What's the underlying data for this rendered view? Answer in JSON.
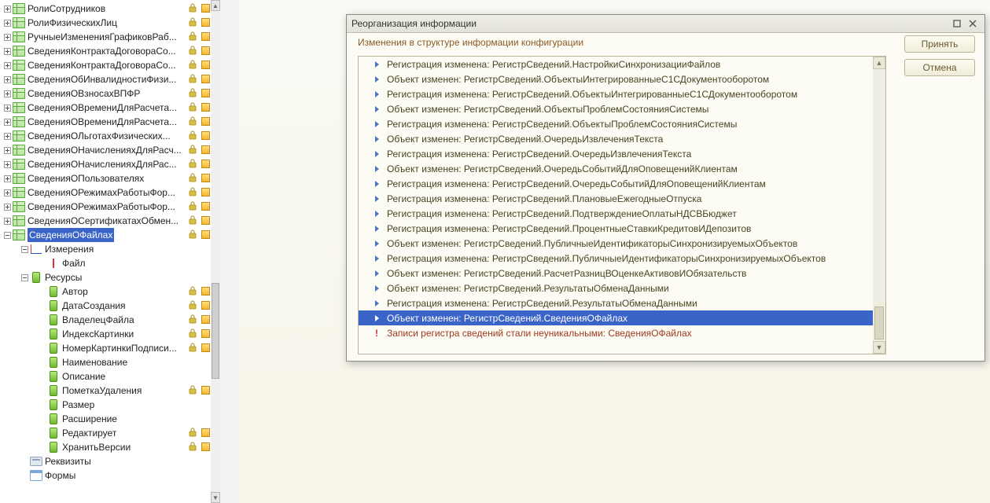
{
  "tree": [
    {
      "depth": 0,
      "exp": "plus",
      "icon": "grid",
      "label": "РолиСотрудников",
      "lock": true,
      "cube": true
    },
    {
      "depth": 0,
      "exp": "plus",
      "icon": "grid",
      "label": "РолиФизическихЛиц",
      "lock": true,
      "cube": true
    },
    {
      "depth": 0,
      "exp": "plus",
      "icon": "grid",
      "label": "РучныеИзмененияГрафиковРаб...",
      "lock": true,
      "cube": true
    },
    {
      "depth": 0,
      "exp": "plus",
      "icon": "grid",
      "label": "СведенияКонтрактаДоговораСо...",
      "lock": true,
      "cube": true
    },
    {
      "depth": 0,
      "exp": "plus",
      "icon": "grid",
      "label": "СведенияКонтрактаДоговораСо...",
      "lock": true,
      "cube": true
    },
    {
      "depth": 0,
      "exp": "plus",
      "icon": "grid",
      "label": "СведенияОбИнвалидностиФизи...",
      "lock": true,
      "cube": true
    },
    {
      "depth": 0,
      "exp": "plus",
      "icon": "grid",
      "label": "СведенияОВзносахВПФР",
      "lock": true,
      "cube": true
    },
    {
      "depth": 0,
      "exp": "plus",
      "icon": "grid",
      "label": "СведенияОВремениДляРасчета...",
      "lock": true,
      "cube": true
    },
    {
      "depth": 0,
      "exp": "plus",
      "icon": "grid",
      "label": "СведенияОВремениДляРасчета...",
      "lock": true,
      "cube": true
    },
    {
      "depth": 0,
      "exp": "plus",
      "icon": "grid",
      "label": "СведенияОЛьготахФизических...",
      "lock": true,
      "cube": true
    },
    {
      "depth": 0,
      "exp": "plus",
      "icon": "grid",
      "label": "СведенияОНачисленияхДляРасч...",
      "lock": true,
      "cube": true
    },
    {
      "depth": 0,
      "exp": "plus",
      "icon": "grid",
      "label": "СведенияОНачисленияхДляРас...",
      "lock": true,
      "cube": true
    },
    {
      "depth": 0,
      "exp": "plus",
      "icon": "grid",
      "label": "СведенияОПользователях",
      "lock": true,
      "cube": true
    },
    {
      "depth": 0,
      "exp": "plus",
      "icon": "grid",
      "label": "СведенияОРежимахРаботыФор...",
      "lock": true,
      "cube": true
    },
    {
      "depth": 0,
      "exp": "plus",
      "icon": "grid",
      "label": "СведенияОРежимахРаботыФор...",
      "lock": true,
      "cube": true
    },
    {
      "depth": 0,
      "exp": "plus",
      "icon": "grid",
      "label": "СведенияОСертификатахОбмен...",
      "lock": true,
      "cube": true
    },
    {
      "depth": 0,
      "exp": "minus",
      "icon": "grid",
      "label": "СведенияОФайлах",
      "lock": true,
      "cube": true,
      "selected": true
    },
    {
      "depth": 1,
      "exp": "minus",
      "icon": "dims",
      "label": "Измерения"
    },
    {
      "depth": 2,
      "exp": "none",
      "icon": "dim",
      "label": "Файл"
    },
    {
      "depth": 1,
      "exp": "minus",
      "icon": "resgrp",
      "label": "Ресурсы"
    },
    {
      "depth": 2,
      "exp": "none",
      "icon": "res",
      "label": "Автор",
      "lock": true,
      "cube": true
    },
    {
      "depth": 2,
      "exp": "none",
      "icon": "res",
      "label": "ДатаСоздания",
      "lock": true,
      "cube": true
    },
    {
      "depth": 2,
      "exp": "none",
      "icon": "res",
      "label": "ВладелецФайла",
      "lock": true,
      "cube": true
    },
    {
      "depth": 2,
      "exp": "none",
      "icon": "res",
      "label": "ИндексКартинки",
      "lock": true,
      "cube": true
    },
    {
      "depth": 2,
      "exp": "none",
      "icon": "res",
      "label": "НомерКартинкиПодписи...",
      "lock": true,
      "cube": true
    },
    {
      "depth": 2,
      "exp": "none",
      "icon": "res",
      "label": "Наименование"
    },
    {
      "depth": 2,
      "exp": "none",
      "icon": "res",
      "label": "Описание"
    },
    {
      "depth": 2,
      "exp": "none",
      "icon": "res",
      "label": "ПометкаУдаления",
      "lock": true,
      "cube": true
    },
    {
      "depth": 2,
      "exp": "none",
      "icon": "res",
      "label": "Размер"
    },
    {
      "depth": 2,
      "exp": "none",
      "icon": "res",
      "label": "Расширение"
    },
    {
      "depth": 2,
      "exp": "none",
      "icon": "res",
      "label": "Редактирует",
      "lock": true,
      "cube": true
    },
    {
      "depth": 2,
      "exp": "none",
      "icon": "res",
      "label": "ХранитьВерсии",
      "lock": true,
      "cube": true
    },
    {
      "depth": 1,
      "exp": "none",
      "icon": "req",
      "label": "Реквизиты"
    },
    {
      "depth": 1,
      "exp": "none",
      "icon": "form",
      "label": "Формы"
    }
  ],
  "dialog": {
    "title": "Реорганизация информации",
    "subtitle": "Изменения в структуре информации конфигурации",
    "accept": "Принять",
    "cancel": "Отмена",
    "rows": [
      {
        "t": "Регистрация изменена: РегистрСведений.НастройкиСинхронизацииФайлов"
      },
      {
        "t": "Объект изменен: РегистрСведений.ОбъектыИнтегрированныеС1СДокументооборотом"
      },
      {
        "t": "Регистрация изменена: РегистрСведений.ОбъектыИнтегрированныеС1СДокументооборотом"
      },
      {
        "t": "Объект изменен: РегистрСведений.ОбъектыПроблемСостоянияСистемы"
      },
      {
        "t": "Регистрация изменена: РегистрСведений.ОбъектыПроблемСостоянияСистемы"
      },
      {
        "t": "Объект изменен: РегистрСведений.ОчередьИзвлеченияТекста"
      },
      {
        "t": "Регистрация изменена: РегистрСведений.ОчередьИзвлеченияТекста"
      },
      {
        "t": "Объект изменен: РегистрСведений.ОчередьСобытийДляОповещенийКлиентам"
      },
      {
        "t": "Регистрация изменена: РегистрСведений.ОчередьСобытийДляОповещенийКлиентам"
      },
      {
        "t": "Регистрация изменена: РегистрСведений.ПлановыеЕжегодныеОтпуска"
      },
      {
        "t": "Регистрация изменена: РегистрСведений.ПодтверждениеОплатыНДСВБюджет"
      },
      {
        "t": "Регистрация изменена: РегистрСведений.ПроцентныеСтавкиКредитовИДепозитов"
      },
      {
        "t": "Объект изменен: РегистрСведений.ПубличныеИдентификаторыСинхронизируемыхОбъектов"
      },
      {
        "t": "Регистрация изменена: РегистрСведений.ПубличныеИдентификаторыСинхронизируемыхОбъектов"
      },
      {
        "t": "Объект изменен: РегистрСведений.РасчетРазницВОценкеАктивовИОбязательств"
      },
      {
        "t": "Объект изменен: РегистрСведений.РезультатыОбменаДанными"
      },
      {
        "t": "Регистрация изменена: РегистрСведений.РезультатыОбменаДанными"
      },
      {
        "t": "Объект изменен: РегистрСведений.СведенияОФайлах",
        "sel": true
      },
      {
        "t": "Записи регистра сведений стали неуникальными: СведенияОФайлах",
        "err": true
      }
    ]
  }
}
